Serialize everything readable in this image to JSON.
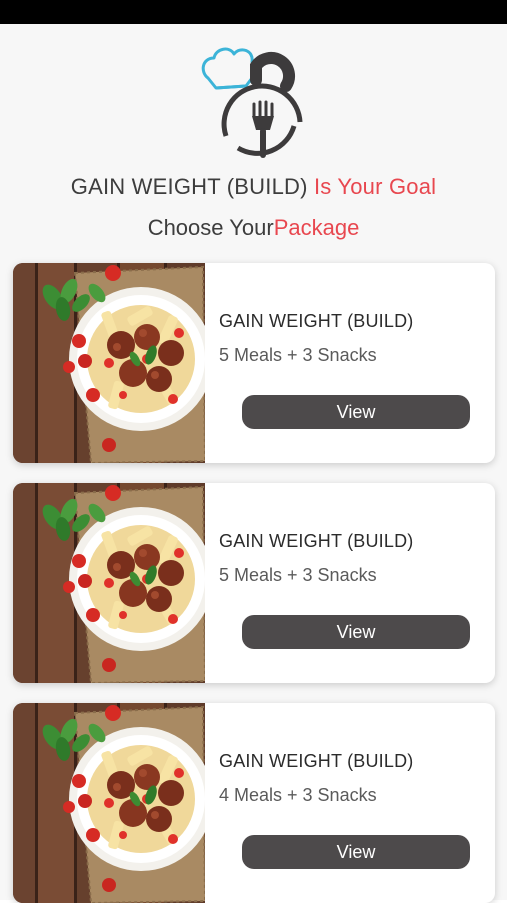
{
  "header": {
    "goal_prefix": "GAIN WEIGHT (BUILD) ",
    "goal_suffix": "Is Your Goal",
    "choose_prefix": "Choose Your",
    "choose_suffix": "Package"
  },
  "logo": {
    "icon": "chef-hat-fork-logo"
  },
  "colors": {
    "accent": "#e8474f",
    "button": "#4d4a4b",
    "logo_blue": "#3cb4d8",
    "logo_dark": "#3d3b3c"
  },
  "packages": [
    {
      "title": "GAIN WEIGHT (BUILD)",
      "subtitle": "5 Meals + 3 Snacks",
      "button": "View",
      "image": "meatballs-pasta-plate"
    },
    {
      "title": "GAIN WEIGHT (BUILD)",
      "subtitle": "5 Meals + 3 Snacks",
      "button": "View",
      "image": "meatballs-pasta-plate"
    },
    {
      "title": "GAIN WEIGHT (BUILD)",
      "subtitle": "4 Meals + 3 Snacks",
      "button": "View",
      "image": "meatballs-pasta-plate"
    }
  ]
}
